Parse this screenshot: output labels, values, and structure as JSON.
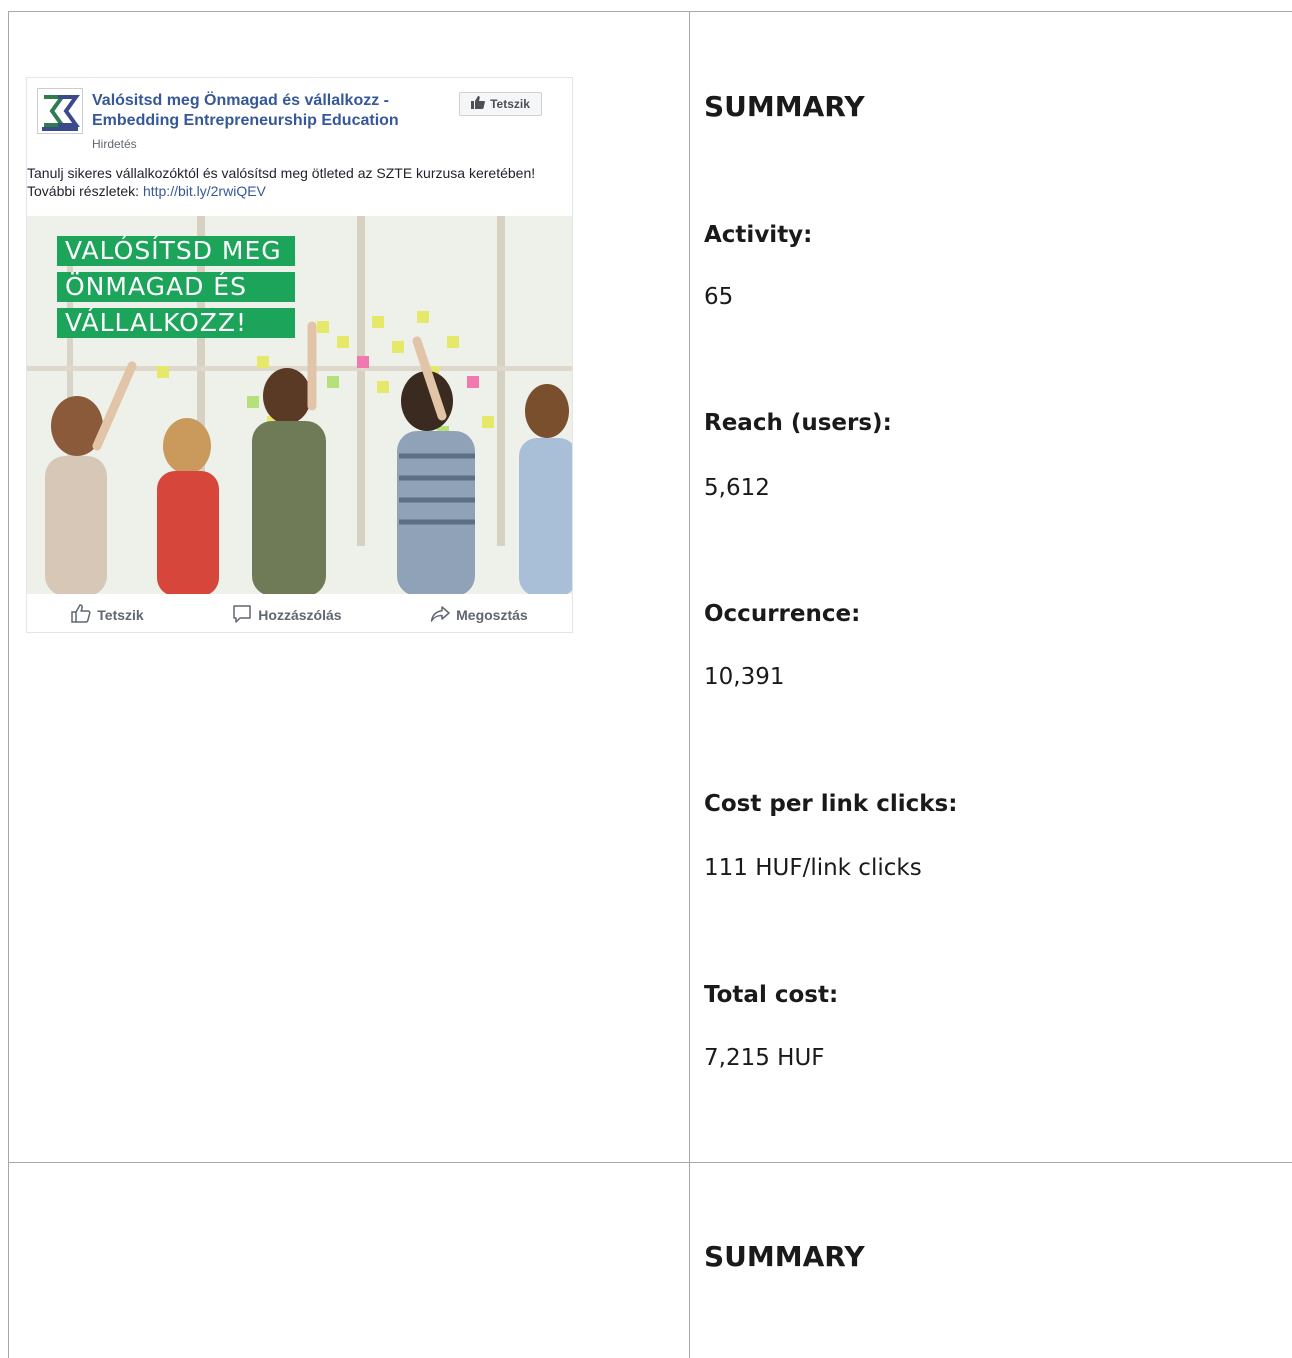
{
  "ad": {
    "page_name": "Valósitsd meg Önmagad és vállalkozz - Embedding Entrepreneurship Education",
    "sponsored": "Hirdetés",
    "like_page_label": "Tetszik",
    "body_text": "Tanulj sikeres vállalkozóktól és valósítsd meg ötleted az SZTE kurzusa keretében! További részletek:",
    "link": "http://bit.ly/2rwiQEV",
    "banner_lines": [
      "VALÓSÍTSD MEG",
      "ÖNMAGAD ÉS",
      "VÁLLALKOZZ!"
    ],
    "actions": {
      "like": "Tetszik",
      "comment": "Hozzászólás",
      "share": "Megosztás"
    },
    "colors": {
      "link": "#365899",
      "banner": "#1ca45a"
    }
  },
  "summary1": {
    "title": "SUMMARY",
    "activity_label": "Activity:",
    "activity_value": "65",
    "reach_label": "Reach (users):",
    "reach_value": "5,612",
    "occurrence_label": "Occurrence:",
    "occurrence_value": "10,391",
    "cpc_label": "Cost per link clicks:",
    "cpc_value": "111 HUF/link clicks",
    "total_label": "Total cost:",
    "total_value": "7,215 HUF"
  },
  "summary2": {
    "title": "SUMMARY"
  }
}
